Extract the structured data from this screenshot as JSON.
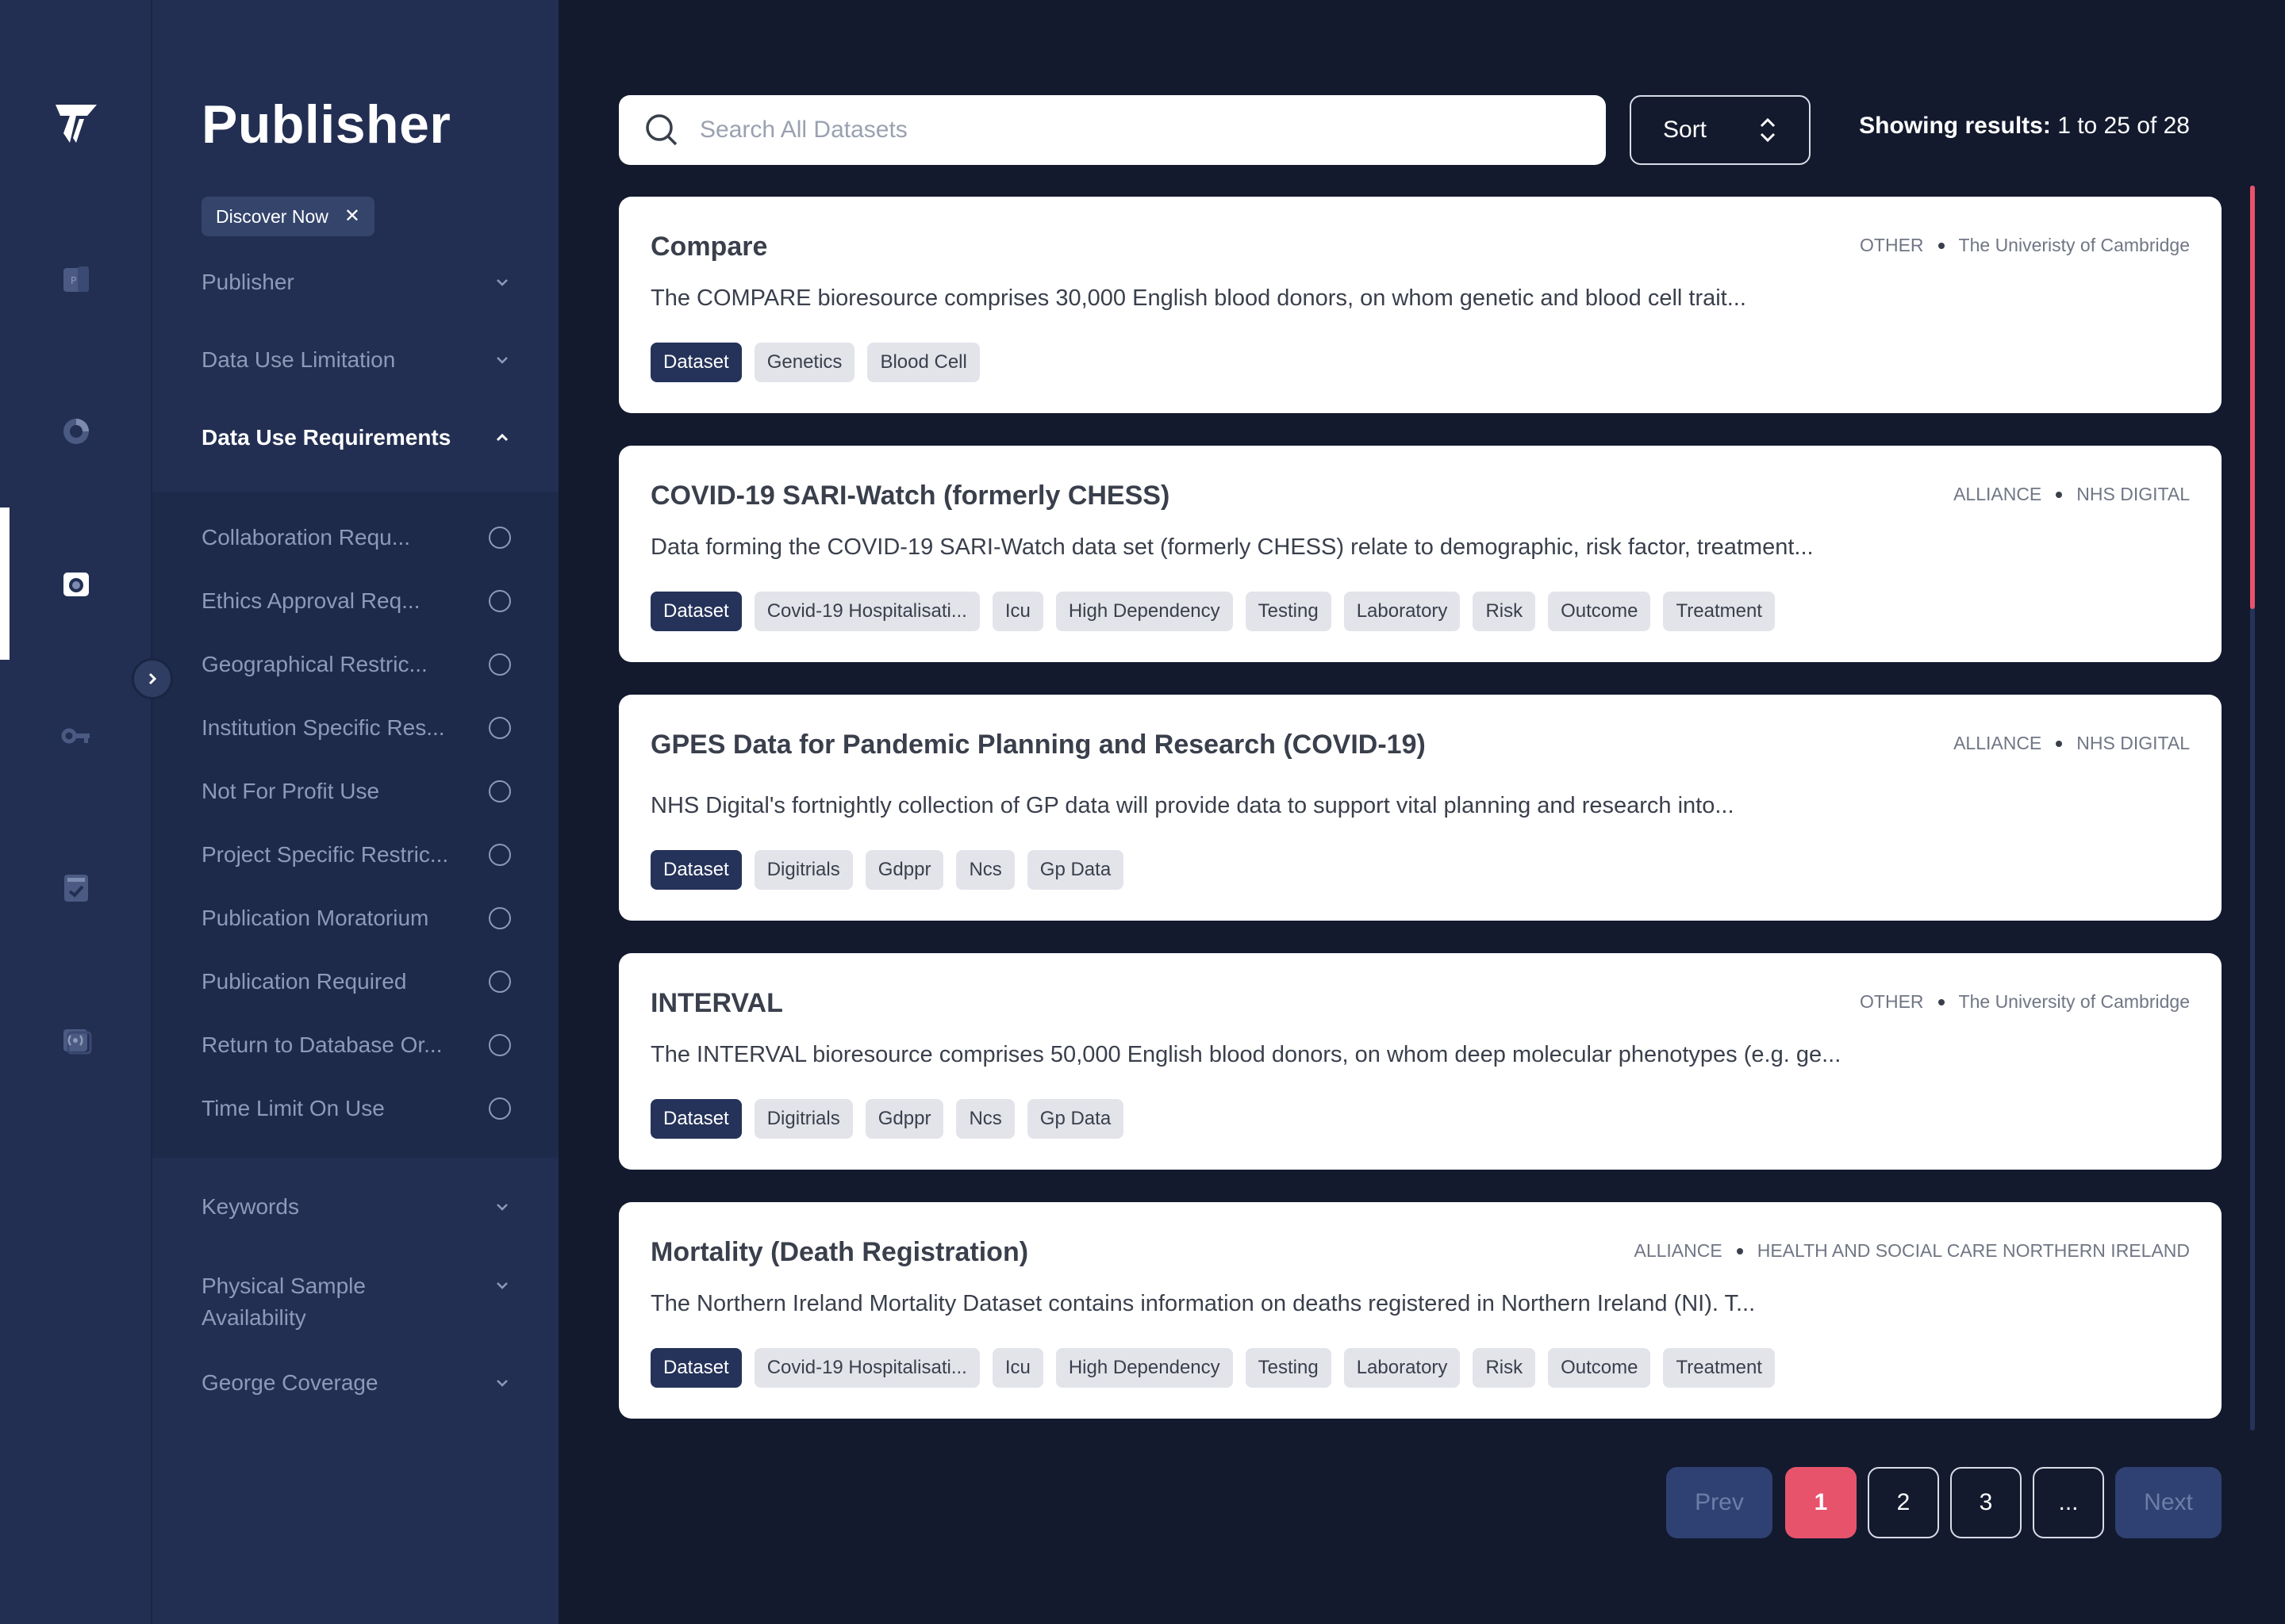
{
  "sidebar": {
    "title": "Publisher",
    "active_chip": "Discover Now",
    "chip_close": "✕",
    "filters_top": [
      {
        "label": "Publisher"
      },
      {
        "label": "Data Use Limitation"
      },
      {
        "label": "Data Use Requirements"
      }
    ],
    "requirements": [
      "Collaboration Requ...",
      "Ethics Approval Req...",
      "Geographical Restric...",
      "Institution Specific Res...",
      "Not For Profit Use",
      "Project Specific Restric...",
      "Publication Moratorium",
      "Publication Required",
      "Return to Database Or...",
      "Time Limit On Use"
    ],
    "filters_bottom": [
      {
        "label": "Keywords"
      },
      {
        "label": "Physical Sample Availability"
      },
      {
        "label": "George Coverage"
      }
    ]
  },
  "search": {
    "placeholder": "Search All Datasets",
    "value": ""
  },
  "sort": {
    "label": "Sort"
  },
  "results": {
    "prefix": "Showing results:",
    "range": "1 to 25 of 28"
  },
  "cards": [
    {
      "title": "Compare",
      "category": "OTHER",
      "publisher": "The Univeristy of Cambridge",
      "description": "The COMPARE bioresource comprises 30,000 English blood donors, on whom genetic and blood cell trait...",
      "tags": [
        "Dataset",
        "Genetics",
        "Blood Cell"
      ]
    },
    {
      "title": "COVID-19 SARI-Watch (formerly CHESS)",
      "category": "ALLIANCE",
      "publisher": "NHS DIGITAL",
      "description": "Data forming the COVID-19 SARI-Watch data set (formerly CHESS) relate to demographic, risk factor, treatment...",
      "tags": [
        "Dataset",
        "Covid-19 Hospitalisati...",
        "Icu",
        "High Dependency",
        "Testing",
        "Laboratory",
        "Risk",
        "Outcome",
        "Treatment"
      ]
    },
    {
      "title": "GPES Data for Pandemic Planning and Research (COVID-19)",
      "category": "ALLIANCE",
      "publisher": "NHS DIGITAL",
      "description": "NHS Digital's fortnightly collection of GP data will provide data to support vital planning and research into...",
      "tags": [
        "Dataset",
        "Digitrials",
        "Gdppr",
        "Ncs",
        "Gp Data"
      ]
    },
    {
      "title": "INTERVAL",
      "category": "OTHER",
      "publisher": "The University of Cambridge",
      "description": "The INTERVAL bioresource comprises 50,000 English blood donors, on whom deep molecular phenotypes (e.g. ge...",
      "tags": [
        "Dataset",
        "Digitrials",
        "Gdppr",
        "Ncs",
        "Gp Data"
      ]
    },
    {
      "title": "Mortality (Death Registration)",
      "category": "ALLIANCE",
      "publisher": "HEALTH AND SOCIAL CARE NORTHERN IRELAND",
      "description": "The Northern Ireland Mortality Dataset contains information on deaths registered in Northern Ireland (NI). T...",
      "tags": [
        "Dataset",
        "Covid-19 Hospitalisati...",
        "Icu",
        "High Dependency",
        "Testing",
        "Laboratory",
        "Risk",
        "Outcome",
        "Treatment"
      ]
    }
  ],
  "pagination": {
    "prev": "Prev",
    "pages": [
      "1",
      "2",
      "3",
      "..."
    ],
    "current": "1",
    "next": "Next"
  },
  "colors": {
    "background": "#131a2e",
    "sidebar": "#222f52",
    "accent": "#e8536c",
    "primary_tag": "#25335a"
  },
  "icons": [
    "logo-icon",
    "publisher-icon",
    "analytics-icon",
    "camera-icon",
    "key-icon",
    "checklist-icon",
    "broadcast-icon",
    "search-icon",
    "sort-icon",
    "chevron-down-icon",
    "chevron-up-icon",
    "chevron-right-icon"
  ]
}
